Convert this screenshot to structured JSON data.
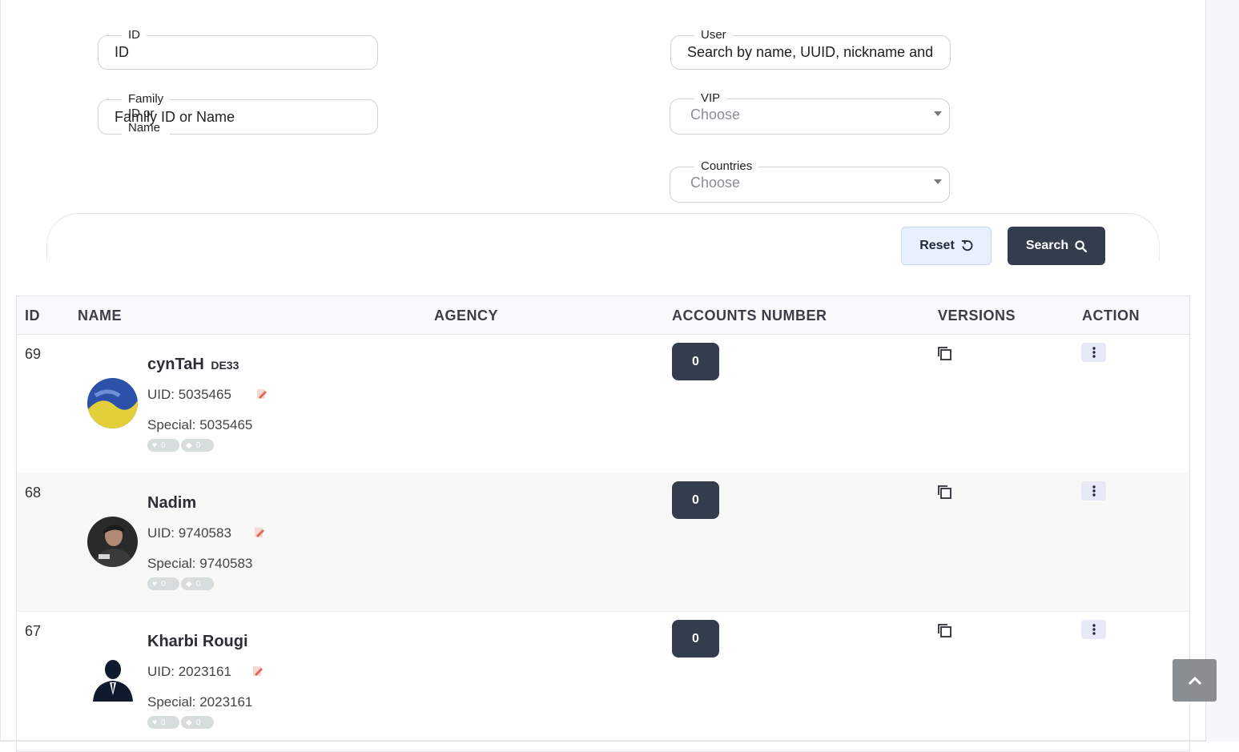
{
  "filters": {
    "id": {
      "label": "ID",
      "value": "ID"
    },
    "family": {
      "label": "Family ID or Name",
      "value": "Family ID or Name"
    },
    "user": {
      "label": "User",
      "value": "Search by name, UUID, nickname and"
    },
    "vip": {
      "label": "VIP",
      "value": "Choose"
    },
    "countries": {
      "label": "Countries",
      "value": "Choose"
    }
  },
  "buttons": {
    "reset": "Reset",
    "search": "Search"
  },
  "table": {
    "headers": {
      "id": "ID",
      "name": "NAME",
      "agency": "AGENCY",
      "accounts": "ACCOUNTS NUMBER",
      "versions": "VERSIONS",
      "action": "ACTION"
    },
    "rows": [
      {
        "id": "69",
        "name": "cynTaH",
        "name_suffix": "DE33",
        "uid": "UID: 5035465",
        "special": "Special: 5035465",
        "pill_a": "0",
        "pill_b": "0",
        "accounts": "0",
        "avatar": "avatar-flag"
      },
      {
        "id": "68",
        "name": "Nadim",
        "uid": "UID: 9740583",
        "special": "Special: 9740583",
        "pill_a": "0",
        "pill_b": "0",
        "accounts": "0",
        "avatar": "avatar-photo"
      },
      {
        "id": "67",
        "name": "Kharbi Rougi",
        "uid": "UID: 2023161",
        "special": "Special: 2023161",
        "pill_a": "0",
        "pill_b": "0",
        "accounts": "0",
        "avatar": "avatar-silhouette"
      }
    ]
  },
  "colors": {
    "primary_dark": "#343d4d",
    "reset_bg": "#e8effd",
    "alt_row": "#f8f8f6",
    "scroll_top": "#8b8e91"
  },
  "icons": [
    "undo-icon",
    "search-icon",
    "edit-icon",
    "heart-icon",
    "diamond-icon",
    "copy-icon",
    "kebab-icon",
    "chevron-up-icon"
  ]
}
